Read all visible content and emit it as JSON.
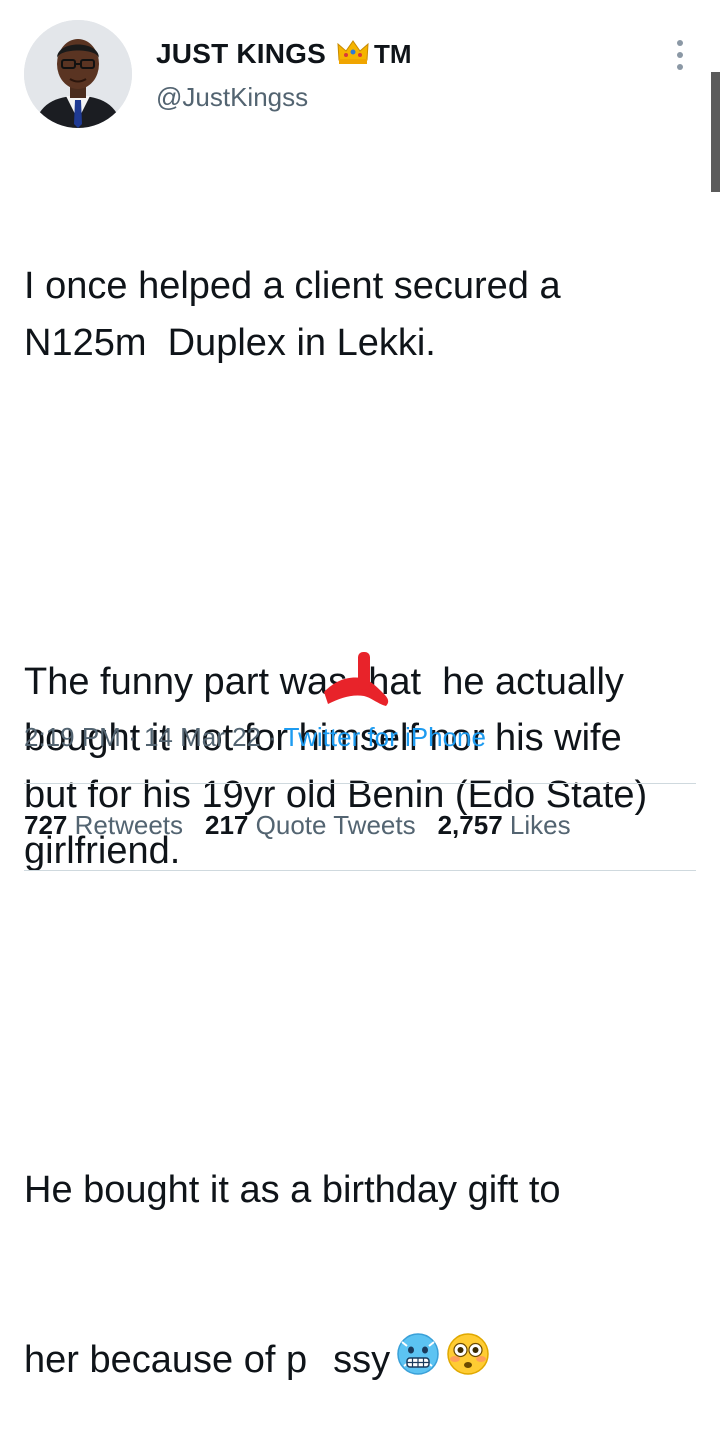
{
  "author": {
    "name": "JUST KINGS",
    "crown_icon": "crown-emoji",
    "suffix": "TM",
    "handle": "@JustKingss"
  },
  "tweet": {
    "paragraph1": "I once helped a client secured a N125m  Duplex in Lekki.",
    "paragraph2": "The funny part was that  he actually bought it not for himself nor his wife but for his 19yr old Benin (Edo State) girlfriend.",
    "paragraph3_line1": "He bought it as a birthday gift to",
    "paragraph3_line2_start": "her because of p",
    "paragraph3_line2_end": "ssy",
    "emojis": [
      "cold-face-emoji",
      "flushed-face-emoji"
    ]
  },
  "meta": {
    "time": "2:19 PM",
    "sep1": " · ",
    "date": "14 Mar 22",
    "sep2": " · ",
    "source": "Twitter for iPhone"
  },
  "stats": {
    "retweets_count": "727",
    "retweets_label": "Retweets",
    "quotes_count": "217",
    "quotes_label": "Quote Tweets",
    "likes_count": "2,757",
    "likes_label": "Likes"
  },
  "colors": {
    "text": "#0f1419",
    "secondary": "#536471",
    "link": "#1d9bf0",
    "divider": "#cfd9de",
    "redaction": "#e8232a"
  }
}
